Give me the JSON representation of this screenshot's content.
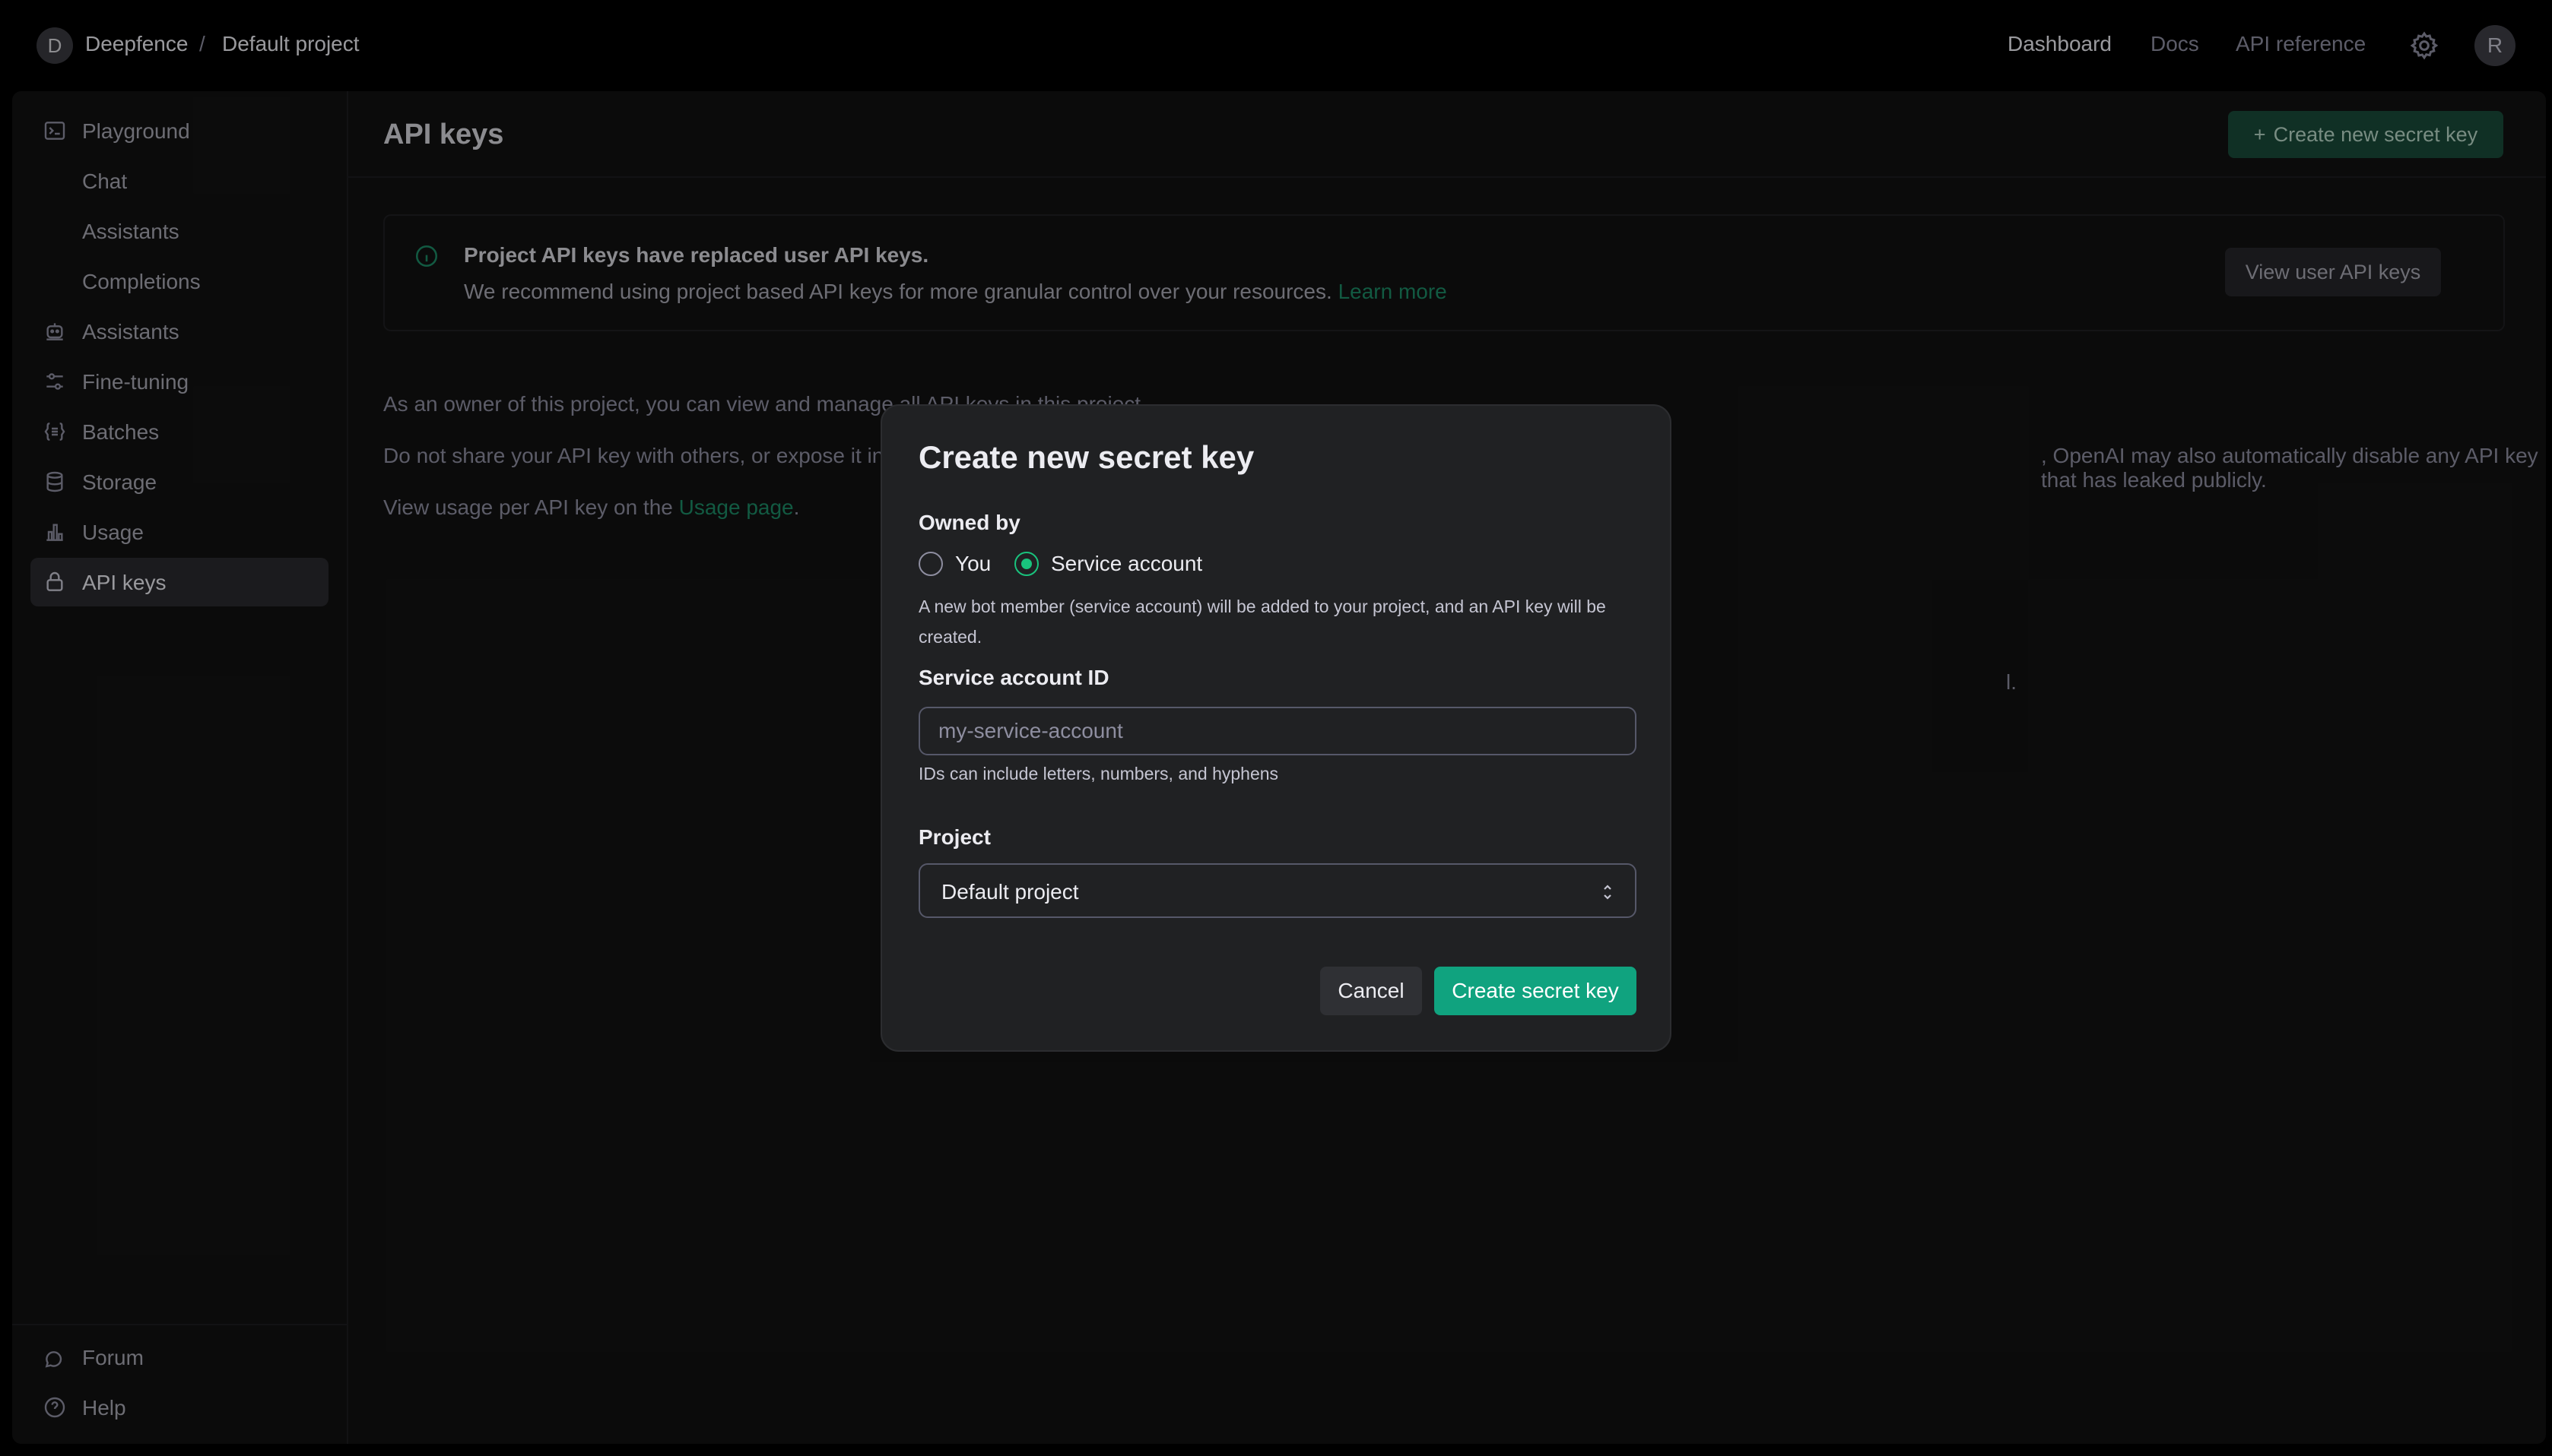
{
  "topbar": {
    "org_initial": "D",
    "org_name": "Deepfence",
    "separator": "/",
    "project_name": "Default project",
    "nav": {
      "dashboard": "Dashboard",
      "docs": "Docs",
      "api_reference": "API reference"
    },
    "user_initial": "R"
  },
  "sidebar": {
    "items": [
      {
        "label": "Playground",
        "icon": "terminal-icon"
      },
      {
        "label": "Chat"
      },
      {
        "label": "Assistants"
      },
      {
        "label": "Completions"
      },
      {
        "label": "Assistants",
        "icon": "robot-icon"
      },
      {
        "label": "Fine-tuning",
        "icon": "sliders-icon"
      },
      {
        "label": "Batches",
        "icon": "list-braces-icon"
      },
      {
        "label": "Storage",
        "icon": "database-icon"
      },
      {
        "label": "Usage",
        "icon": "bar-chart-icon"
      },
      {
        "label": "API keys",
        "icon": "lock-icon",
        "active": true
      }
    ],
    "footer": [
      {
        "label": "Forum",
        "icon": "chat-bubbles-icon"
      },
      {
        "label": "Help",
        "icon": "help-circle-icon"
      }
    ]
  },
  "main": {
    "title": "API keys",
    "create_button": "Create new secret key",
    "notice": {
      "title": "Project API keys have replaced user API keys.",
      "body": "We recommend using project based API keys for more granular control over your resources.",
      "link": "Learn more",
      "button": "View user API keys"
    },
    "para1": "As an owner of this project, you can view and manage all API keys in this project.",
    "para2a": "Do not share your API key with others, or expose it in",
    "para2b": ", OpenAI may also automatically disable any API key that has leaked publicly.",
    "para3_prefix": "View usage per API key on the",
    "para3_link": "Usage page",
    "para3_suffix": ".",
    "stray": "l."
  },
  "modal": {
    "title": "Create new secret key",
    "owned_by_label": "Owned by",
    "option_you": "You",
    "option_service": "Service account",
    "selected_owner": "Service account",
    "service_help": "A new bot member (service account) will be added to your project, and an API key will be created.",
    "service_id_label": "Service account ID",
    "service_id_placeholder": "my-service-account",
    "service_id_value": "",
    "service_id_help": "IDs can include letters, numbers, and hyphens",
    "project_label": "Project",
    "project_value": "Default project",
    "cancel": "Cancel",
    "submit": "Create secret key"
  },
  "colors": {
    "accent": "#10a37f",
    "link": "#1d8a66",
    "background": "#121212"
  }
}
